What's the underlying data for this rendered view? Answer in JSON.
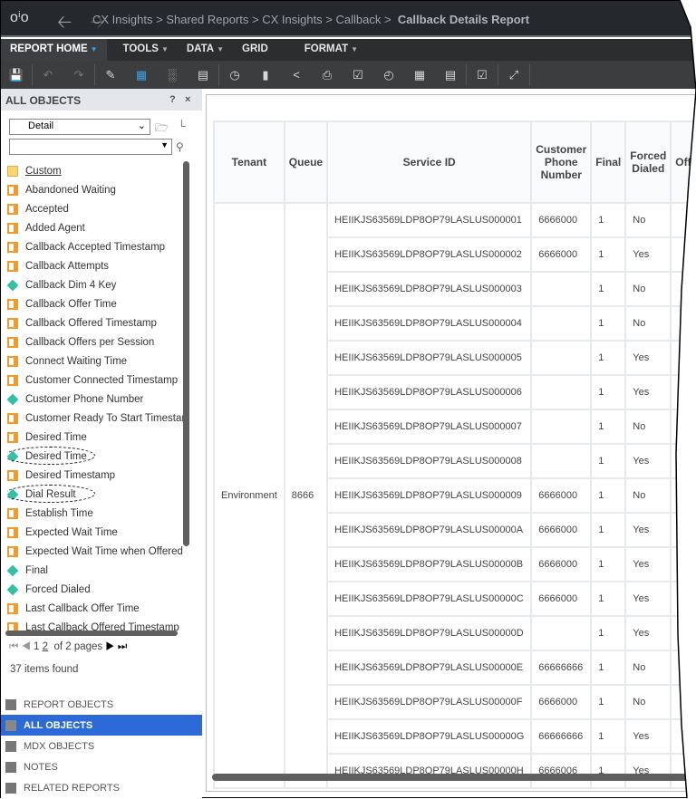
{
  "breadcrumb": [
    "CX Insights",
    "Shared Reports",
    "CX Insights",
    "Callback"
  ],
  "report_title": "Callback Details Report",
  "menus": [
    "REPORT HOME",
    "TOOLS",
    "DATA",
    "GRID",
    "FORMAT"
  ],
  "panel": {
    "title": "ALL OBJECTS",
    "help": "?",
    "close": "×",
    "view_select": "Detail",
    "search_value": "",
    "items": [
      {
        "label": "Custom",
        "type": "folder"
      },
      {
        "label": "Abandoned Waiting",
        "type": "attribute"
      },
      {
        "label": "Accepted",
        "type": "attribute"
      },
      {
        "label": "Added Agent",
        "type": "attribute"
      },
      {
        "label": "Callback Accepted Timestamp",
        "type": "attribute"
      },
      {
        "label": "Callback Attempts",
        "type": "attribute"
      },
      {
        "label": "Callback Dim 4 Key",
        "type": "metric"
      },
      {
        "label": "Callback Offer Time",
        "type": "attribute"
      },
      {
        "label": "Callback Offered Timestamp",
        "type": "attribute"
      },
      {
        "label": "Callback Offers per Session",
        "type": "attribute"
      },
      {
        "label": "Connect Waiting Time",
        "type": "attribute"
      },
      {
        "label": "Customer Connected Timestamp",
        "type": "attribute"
      },
      {
        "label": "Customer Phone Number",
        "type": "metric"
      },
      {
        "label": "Customer Ready To Start Timestamp",
        "type": "attribute"
      },
      {
        "label": "Desired Time",
        "type": "attribute"
      },
      {
        "label": "Desired Time",
        "type": "metric",
        "circled": true
      },
      {
        "label": "Desired Timestamp",
        "type": "attribute"
      },
      {
        "label": "Dial Result",
        "type": "metric",
        "circled": true
      },
      {
        "label": "Establish Time",
        "type": "attribute"
      },
      {
        "label": "Expected Wait Time",
        "type": "attribute"
      },
      {
        "label": "Expected Wait Time when Offered",
        "type": "attribute"
      },
      {
        "label": "Final",
        "type": "metric"
      },
      {
        "label": "Forced Dialed",
        "type": "metric"
      },
      {
        "label": "Last Callback Offer Time",
        "type": "attribute"
      },
      {
        "label": "Last Callback Offered Timestamp",
        "type": "attribute"
      }
    ],
    "pager": {
      "page1": "1",
      "page2": "2",
      "of_pages": "of 2 pages"
    },
    "found": "37 items found",
    "bottom_tabs": [
      "REPORT OBJECTS",
      "ALL OBJECTS",
      "MDX OBJECTS",
      "NOTES",
      "RELATED REPORTS"
    ]
  },
  "grid": {
    "headers": [
      "Tenant",
      "Queue",
      "Service ID",
      "Customer Phone Number",
      "Final",
      "Forced Dialed",
      "Offe"
    ],
    "tenant": "Environment",
    "queue": "8666",
    "rows": [
      [
        "HEIIKJS63569LDP8OP79LASLUS000001",
        "6666000",
        "1",
        "No"
      ],
      [
        "HEIIKJS63569LDP8OP79LASLUS000002",
        "6666000",
        "1",
        "Yes"
      ],
      [
        "HEIIKJS63569LDP8OP79LASLUS000003",
        "",
        "1",
        "No"
      ],
      [
        "HEIIKJS63569LDP8OP79LASLUS000004",
        "",
        "1",
        "No"
      ],
      [
        "HEIIKJS63569LDP8OP79LASLUS000005",
        "",
        "1",
        "Yes"
      ],
      [
        "HEIIKJS63569LDP8OP79LASLUS000006",
        "",
        "1",
        "Yes"
      ],
      [
        "HEIIKJS63569LDP8OP79LASLUS000007",
        "",
        "1",
        "No"
      ],
      [
        "HEIIKJS63569LDP8OP79LASLUS000008",
        "",
        "1",
        "Yes"
      ],
      [
        "HEIIKJS63569LDP8OP79LASLUS000009",
        "6666000",
        "1",
        "No"
      ],
      [
        "HEIIKJS63569LDP8OP79LASLUS00000A",
        "6666000",
        "1",
        "Yes"
      ],
      [
        "HEIIKJS63569LDP8OP79LASLUS00000B",
        "6666000",
        "1",
        "Yes"
      ],
      [
        "HEIIKJS63569LDP8OP79LASLUS00000C",
        "6666000",
        "1",
        "Yes"
      ],
      [
        "HEIIKJS63569LDP8OP79LASLUS00000D",
        "",
        "1",
        "Yes"
      ],
      [
        "HEIIKJS63569LDP8OP79LASLUS00000E",
        "66666666",
        "1",
        "No"
      ],
      [
        "HEIIKJS63569LDP8OP79LASLUS00000F",
        "6666000",
        "1",
        "No"
      ],
      [
        "HEIIKJS63569LDP8OP79LASLUS00000G",
        "66666666",
        "1",
        "Yes"
      ],
      [
        "HEIIKJS63569LDP8OP79LASLUS00000H",
        "6666006",
        "1",
        "Yes"
      ]
    ]
  }
}
